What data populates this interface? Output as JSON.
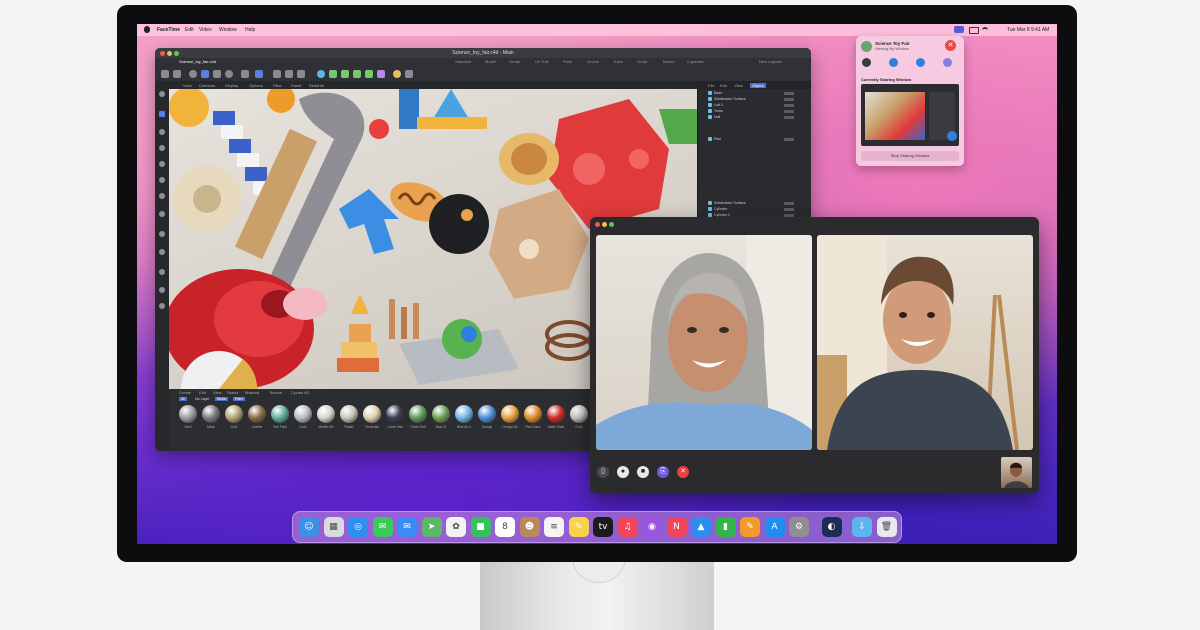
{
  "menubar": {
    "app": "FaceTime",
    "items": [
      "Edit",
      "Video",
      "Window",
      "Help"
    ],
    "clock": "Tue Mar 8 9:41 AM"
  },
  "c4d": {
    "window_title": "Science_toy_fair.c4d - Main",
    "file_tab": "Science_toy_fair.c4d",
    "layout_tabs": [
      "Standard",
      "Model",
      "Sculpt",
      "UV Edit",
      "Paint",
      "Groom",
      "Track",
      "Script",
      "Nodes",
      "Capsules",
      "New Layouts"
    ],
    "viewport_menu": [
      "View",
      "Cameras",
      "Display",
      "Options",
      "Filter",
      "Panel",
      "Redshift"
    ],
    "objman_menu": [
      "File",
      "Edit",
      "View",
      "Object"
    ],
    "objects": [
      "Base",
      "Subdivision Surface",
      "Loft.1",
      "Torus",
      "Null",
      "Rise",
      "Subdivision Surface",
      "Cylinder",
      "Cylinder.2",
      "Cylinder.1",
      "Cylinder",
      "Cylinder.3",
      "Subdivision Surface",
      "Cylinder.5",
      "Cylinder.4",
      "Cylinder.6",
      "Cylinder.3"
    ],
    "mat_menu": [
      "Create",
      "Edit",
      "View",
      "Select",
      "Material",
      "Texture",
      "Cycles 4D"
    ],
    "mat_filters": [
      "All",
      "No Layer",
      "Metal",
      "Paint"
    ],
    "materials": [
      {
        "name": "Steel",
        "color": "#9c9ca2"
      },
      {
        "name": "Metal",
        "color": "#7a7b80"
      },
      {
        "name": "Gold",
        "color": "#b4a375"
      },
      {
        "name": "Leather",
        "color": "#8a6a4a"
      },
      {
        "name": "Teal Paint",
        "color": "#5fae9c"
      },
      {
        "name": "Cloth",
        "color": "#b9bcc0"
      },
      {
        "name": "Marble Wh",
        "color": "#d7d4d0"
      },
      {
        "name": "Plastic",
        "color": "#c9c4bc"
      },
      {
        "name": "Terracotta",
        "color": "#e0d0b0"
      },
      {
        "name": "Green Mat",
        "color": "#3b3d55"
      },
      {
        "name": "Green Soft",
        "color": "#5c9b5a"
      },
      {
        "name": "Blue Gl",
        "color": "#6f9f55"
      },
      {
        "name": "Blue Art 3",
        "color": "#74b4e4"
      },
      {
        "name": "Orange",
        "color": "#4f8fd8"
      },
      {
        "name": "Orange Alt",
        "color": "#e7a23e"
      },
      {
        "name": "Red Glass",
        "color": "#e28a2e"
      },
      {
        "name": "Matte Paint",
        "color": "#cf2a2a"
      },
      {
        "name": "Fuzz",
        "color": "#c5c3bf"
      }
    ]
  },
  "facetime": {
    "controls": [
      "sidebar-toggle",
      "mute",
      "camera",
      "shareplay",
      "end-call"
    ]
  },
  "shareplay": {
    "title": "Science Toy Fair",
    "subtitle": "Viewing My Window",
    "section": "Currently Sharing Window",
    "stop": "Stop Sharing Window"
  },
  "dock": {
    "apps": [
      {
        "name": "finder",
        "color": "#3d8fe8",
        "glyph": "☺"
      },
      {
        "name": "launchpad",
        "color": "#d9d9de",
        "glyph": "▦"
      },
      {
        "name": "safari",
        "color": "#2e8ff0",
        "glyph": "◎"
      },
      {
        "name": "messages",
        "color": "#3cc85a",
        "glyph": "✉"
      },
      {
        "name": "mail",
        "color": "#3a8cf2",
        "glyph": "✉"
      },
      {
        "name": "maps",
        "color": "#5fb86a",
        "glyph": "➤"
      },
      {
        "name": "photos",
        "color": "#f2f2f2",
        "glyph": "✿"
      },
      {
        "name": "facetime",
        "color": "#36c25a",
        "glyph": "■"
      },
      {
        "name": "calendar",
        "color": "#ffffff",
        "glyph": "8"
      },
      {
        "name": "contacts",
        "color": "#b88a5a",
        "glyph": "☻"
      },
      {
        "name": "reminders",
        "color": "#f4f4f4",
        "glyph": "≡"
      },
      {
        "name": "notes",
        "color": "#f7d24a",
        "glyph": "✎"
      },
      {
        "name": "tv",
        "color": "#1b1b1d",
        "glyph": "tv"
      },
      {
        "name": "music",
        "color": "#f0465c",
        "glyph": "♫"
      },
      {
        "name": "podcasts",
        "color": "#9b54e0",
        "glyph": "◉"
      },
      {
        "name": "news",
        "color": "#f0465c",
        "glyph": "N"
      },
      {
        "name": "keynote",
        "color": "#2f8cf1",
        "glyph": "▲"
      },
      {
        "name": "numbers",
        "color": "#33b54a",
        "glyph": "▮"
      },
      {
        "name": "pages",
        "color": "#f39a2b",
        "glyph": "✎"
      },
      {
        "name": "app-store",
        "color": "#1f8ef2",
        "glyph": "A"
      },
      {
        "name": "system-preferences",
        "color": "#8e8e93",
        "glyph": "⚙"
      },
      {
        "name": "cinema-4d",
        "color": "#1b2d55",
        "glyph": "◐"
      },
      {
        "name": "downloads",
        "color": "#5cb4f0",
        "glyph": "⇩"
      },
      {
        "name": "trash",
        "color": "#e8e8ee",
        "glyph": "🗑"
      }
    ]
  }
}
